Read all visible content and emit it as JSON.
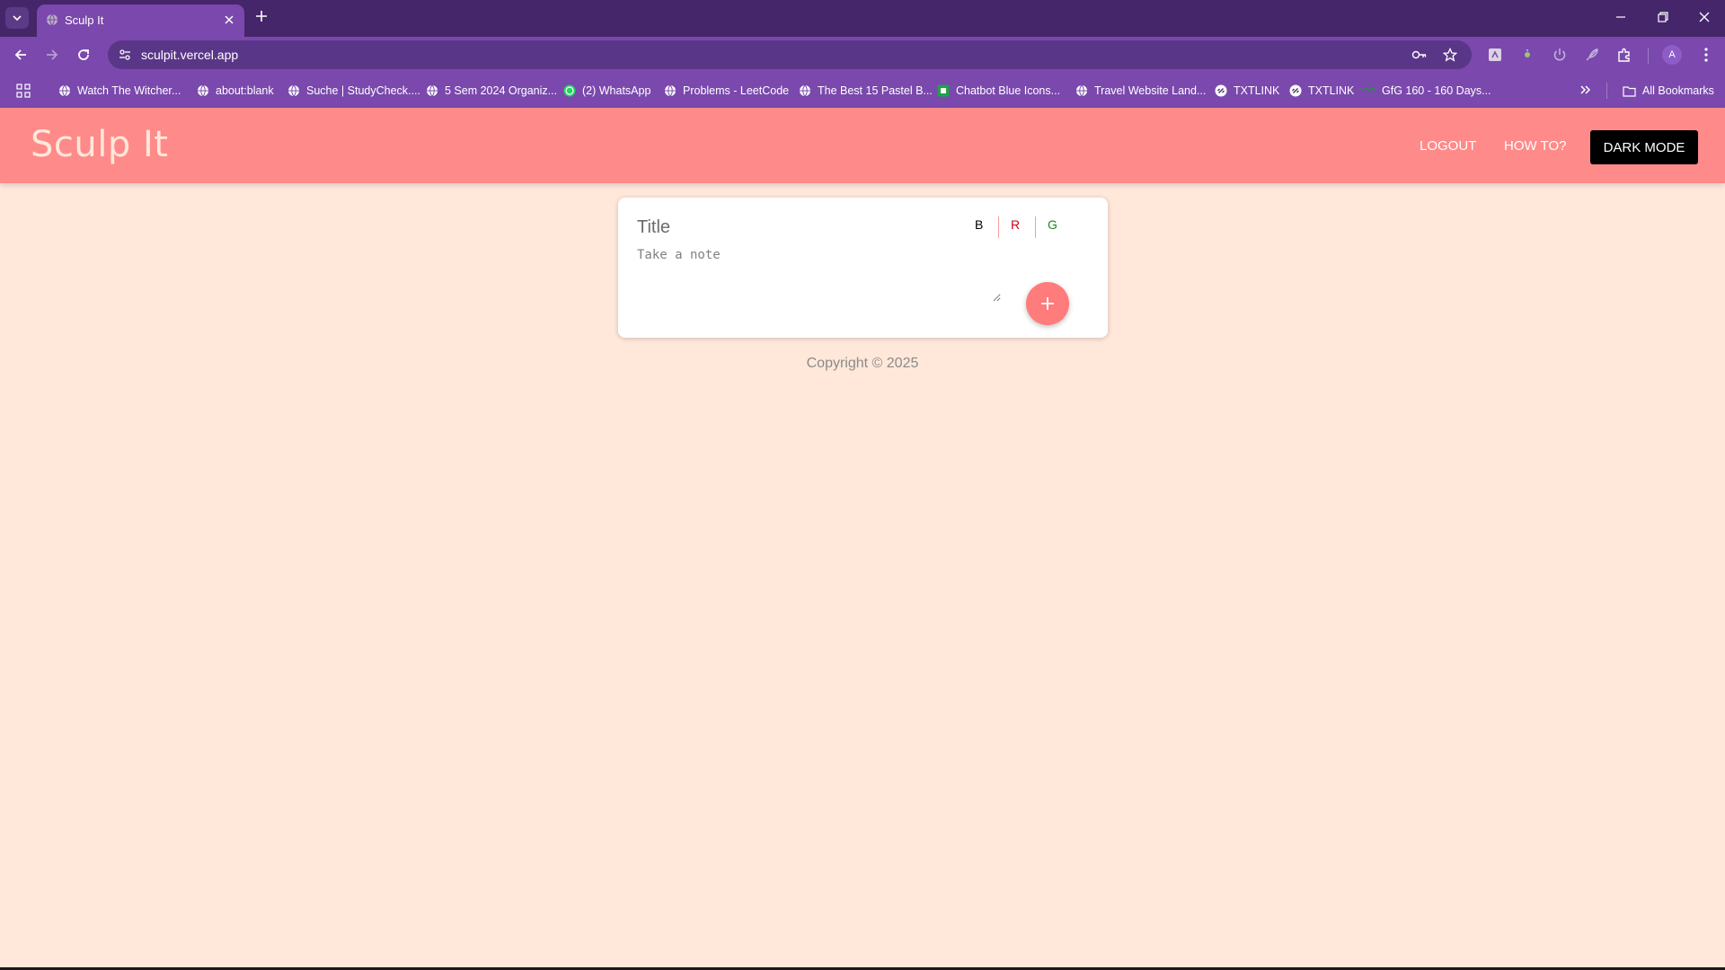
{
  "browser": {
    "tab": {
      "title": "Sculp It"
    },
    "address_bar": {
      "url": "sculpit.vercel.app"
    },
    "profile_initial": "A",
    "bookmarks": [
      {
        "label": "Watch The Witcher...",
        "icon": "globe-icon"
      },
      {
        "label": "about:blank",
        "icon": "globe-icon"
      },
      {
        "label": "Suche | StudyCheck....",
        "icon": "globe-icon"
      },
      {
        "label": "5 Sem 2024 Organiz...",
        "icon": "globe-icon"
      },
      {
        "label": "(2) WhatsApp",
        "icon": "whatsapp-icon"
      },
      {
        "label": "Problems - LeetCode",
        "icon": "globe-icon"
      },
      {
        "label": "The Best 15 Pastel B...",
        "icon": "globe-icon"
      },
      {
        "label": "Chatbot Blue Icons...",
        "icon": "green-square-icon"
      },
      {
        "label": "Travel Website Land...",
        "icon": "globe-icon"
      },
      {
        "label": "TXTLINK",
        "icon": "link-icon"
      },
      {
        "label": "TXTLINK",
        "icon": "link-icon"
      },
      {
        "label": "GfG 160 - 160 Days...",
        "icon": "gfg-icon"
      }
    ],
    "all_bookmarks_label": "All Bookmarks"
  },
  "app": {
    "brand": "Sculp It",
    "nav": {
      "logout": "LOGOUT",
      "how_to": "HOW TO?",
      "dark_mode": "DARK MODE"
    },
    "note_form": {
      "title_placeholder": "Title",
      "note_placeholder": "Take a note",
      "format_buttons": {
        "bold": "B",
        "red": "R",
        "green": "G"
      },
      "add_icon": "plus-icon"
    },
    "footer": "Copyright © 2025"
  },
  "colors": {
    "page_background": "#ffe8da",
    "header_background": "#ff8a8a",
    "accent": "#ff7c7c",
    "red_format": "#d0021b",
    "green_format": "#1a8a1a",
    "browser_frame": "#7b48ad"
  }
}
